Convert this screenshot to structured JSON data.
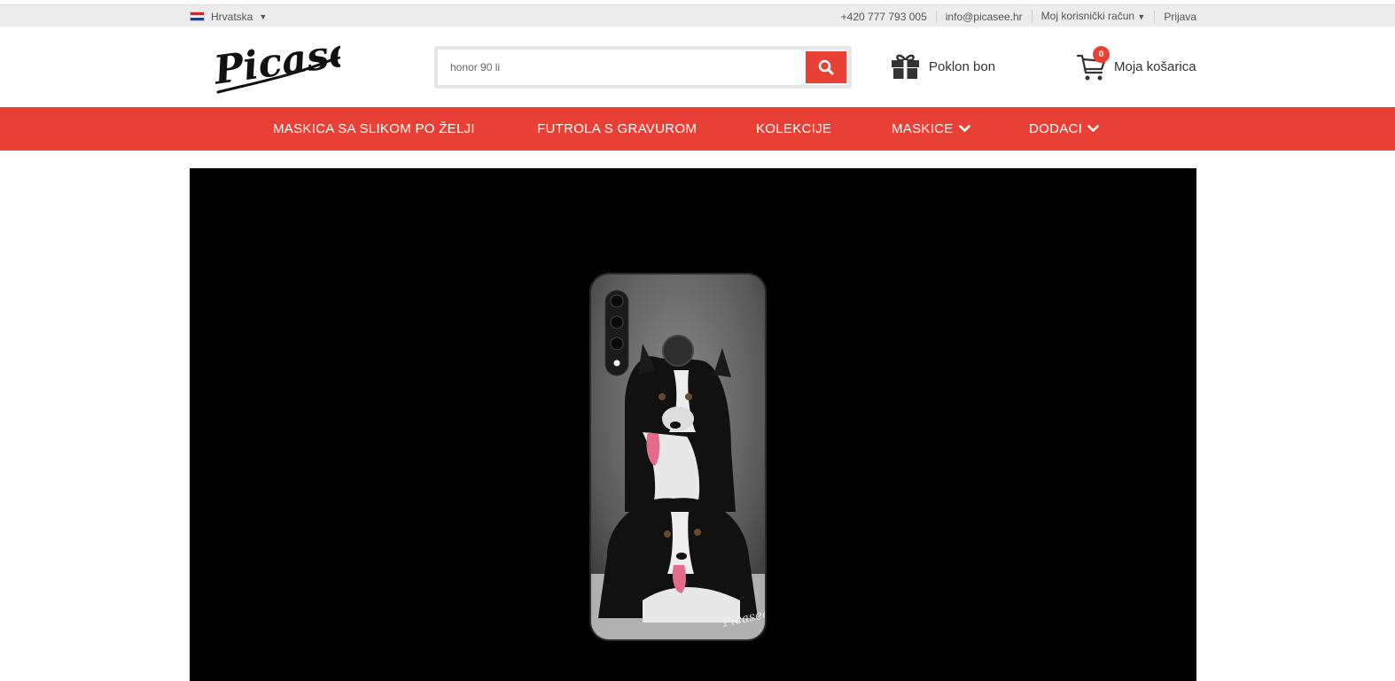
{
  "topbar": {
    "language": "Hrvatska",
    "phone": "+420 777 793 005",
    "email": "info@picasee.hr",
    "account": "Moj korisnički račun",
    "login": "Prijava"
  },
  "header": {
    "logo_text": "Picasee",
    "search": {
      "value": "honor 90 li",
      "icon": "search-icon"
    },
    "gift_label": "Poklon bon",
    "cart_label": "Moja košarica",
    "cart_count": "0"
  },
  "nav": {
    "items": [
      {
        "label": "MASKICA SA SLIKOM PO ŽELJI",
        "dropdown": false
      },
      {
        "label": "FUTROLA S GRAVUROM",
        "dropdown": false
      },
      {
        "label": "KOLEKCIJE",
        "dropdown": false
      },
      {
        "label": "MASKICE",
        "dropdown": true
      },
      {
        "label": "DODACI",
        "dropdown": true
      }
    ]
  },
  "hero": {
    "watermark": "Picasee"
  },
  "colors": {
    "accent": "#e84034",
    "topbar_bg": "#ececec",
    "hero_bg": "#000000"
  }
}
